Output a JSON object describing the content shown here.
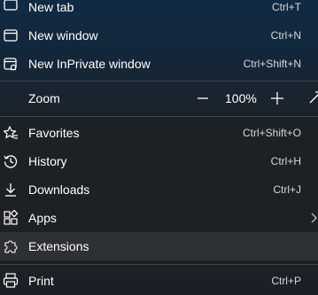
{
  "menu": {
    "new_tab": {
      "label": "New tab",
      "shortcut": "Ctrl+T",
      "icon": "new-tab-icon"
    },
    "new_window": {
      "label": "New window",
      "shortcut": "Ctrl+N",
      "icon": "new-window-icon"
    },
    "new_inprivate": {
      "label": "New InPrivate window",
      "shortcut": "Ctrl+Shift+N",
      "icon": "inprivate-window-icon"
    },
    "zoom": {
      "label": "Zoom",
      "minus": "−",
      "value": "100%",
      "plus": "+",
      "fullscreen_icon": "fullscreen-icon"
    },
    "favorites": {
      "label": "Favorites",
      "shortcut": "Ctrl+Shift+O",
      "icon": "favorites-icon"
    },
    "history": {
      "label": "History",
      "shortcut": "Ctrl+H",
      "icon": "history-icon"
    },
    "downloads": {
      "label": "Downloads",
      "shortcut": "Ctrl+J",
      "icon": "download-icon"
    },
    "apps": {
      "label": "Apps",
      "icon": "apps-icon",
      "submenu_icon": "chevron-right-icon"
    },
    "extensions": {
      "label": "Extensions",
      "icon": "extensions-icon",
      "highlighted": true
    },
    "print": {
      "label": "Print",
      "shortcut": "Ctrl+P",
      "icon": "print-icon"
    }
  },
  "colors": {
    "background_top": "#102a44",
    "background_bottom": "#1d2024",
    "highlight": "#2d3035",
    "separator": "#3e4247",
    "text": "#ffffff",
    "shortcut_text": "#d6d8da"
  }
}
